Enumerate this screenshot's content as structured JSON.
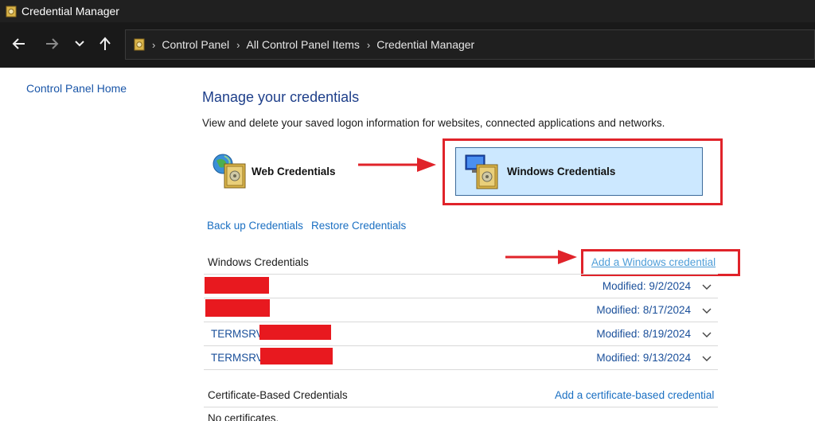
{
  "window": {
    "title": "Credential Manager",
    "icon": "credential-vault-icon"
  },
  "nav": {
    "back_icon": "arrow-left-icon",
    "forward_icon": "arrow-right-icon",
    "recent_icon": "chevron-down-icon",
    "up_icon": "arrow-up-icon",
    "breadcrumb": [
      "Control Panel",
      "All Control Panel Items",
      "Credential Manager"
    ]
  },
  "sidebar": {
    "home_link": "Control Panel Home"
  },
  "main": {
    "heading": "Manage your credentials",
    "description": "View and delete your saved logon information for websites, connected applications and networks.",
    "web_credentials_label": "Web Credentials",
    "windows_credentials_label": "Windows Credentials",
    "backup_link": "Back up Credentials",
    "restore_link": "Restore Credentials"
  },
  "windows_section": {
    "title": "Windows Credentials",
    "add_link": "Add a Windows credential",
    "items": [
      {
        "name": "",
        "modified": "Modified:  9/2/2024"
      },
      {
        "name": "",
        "modified": "Modified:  8/17/2024"
      },
      {
        "name": "TERMSRV/",
        "modified": "Modified:  8/19/2024"
      },
      {
        "name": "TERMSRV/",
        "modified": "Modified:  9/13/2024"
      }
    ]
  },
  "certificate_section": {
    "title": "Certificate-Based Credentials",
    "add_link": "Add a certificate-based credential",
    "empty_text": "No certificates."
  },
  "colors": {
    "accent_link": "#1a6fc2",
    "highlight_red": "#e0232a",
    "selected_tile": "#cce8ff",
    "titlebar": "#202020"
  }
}
